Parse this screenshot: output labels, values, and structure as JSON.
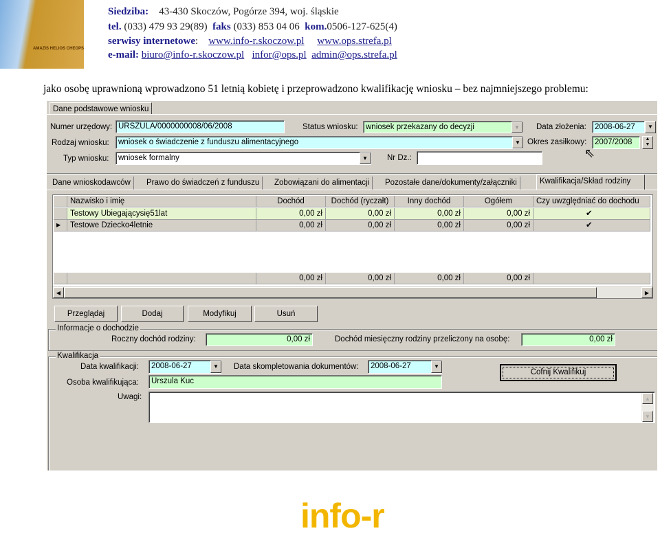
{
  "header": {
    "siedziba_label": "Siedziba:",
    "siedziba": "43-430 Skoczów,  Pogórze 394,  woj. śląskie",
    "tel_label": "tel.",
    "tel": "(033) 479 93 29(89)",
    "faks_label": "faks",
    "faks": "(033) 853 04 06",
    "kom_label": "kom.",
    "kom": "0506-127-625(4)",
    "serwisy_label": "serwisy internetowe",
    "serwisy_links": [
      "www.info-r.skoczow.pl",
      "www.ops.strefa.pl"
    ],
    "email_label": "e-mail:",
    "emails": [
      "biuro@info-r.skoczow.pl",
      "infor@ops.pl",
      "admin@ops.strefa.pl"
    ],
    "logo_text": "AMAZIS HELIOS CHEOPS"
  },
  "intro": "jako osobę uprawnioną wprowadzono 51 letnią kobietę i przeprowadzono kwalifikację wniosku – bez najmniejszego problemu:",
  "app": {
    "top_tab": "Dane podstawowe wniosku",
    "fields": {
      "numer_label": "Numer urzędowy:",
      "numer": "URSZULA/0000000008/06/2008",
      "status_label": "Status wniosku:",
      "status": "wniosek przekazany do decyzji",
      "data_zlozenia_label": "Data złożenia:",
      "data_zlozenia": "2008-06-27",
      "rodzaj_label": "Rodzaj wniosku:",
      "rodzaj": "wniosek o świadczenie z funduszu alimentacyjnego",
      "okres_label": "Okres zasiłkowy:",
      "okres": "2007/2008",
      "typ_label": "Typ wniosku:",
      "typ": "wniosek formalny",
      "nrdz_label": "Nr Dz.:",
      "nrdz": ""
    },
    "tabs": [
      "Dane wnioskodawców",
      "Prawo do świadczeń z funduszu",
      "Zobowiązani do alimentacji",
      "Pozostałe dane/dokumenty/załączniki",
      "Kwalifikacja/Skład rodziny"
    ],
    "active_tab": 4,
    "grid": {
      "columns": [
        "Nazwisko i imię",
        "Dochód",
        "Dochód (ryczałt)",
        "Inny dochód",
        "Ogółem",
        "Czy uwzględniać do dochodu"
      ],
      "rows": [
        {
          "name": "Testowy Ubiegającysię51lat",
          "values": [
            "0,00 zł",
            "0,00 zł",
            "0,00 zł",
            "0,00 zł"
          ],
          "checked": true
        },
        {
          "name": "Testowe Dziecko4letnie",
          "values": [
            "0,00 zł",
            "0,00 zł",
            "0,00 zł",
            "0,00 zł"
          ],
          "checked": true
        }
      ],
      "totals": [
        "0,00 zł",
        "0,00 zł",
        "0,00 zł",
        "0,00 zł"
      ]
    },
    "buttons": [
      "Przeglądaj",
      "Dodaj",
      "Modyfikuj",
      "Usuń"
    ],
    "income": {
      "group": "Informacje o dochodzie",
      "roczny_label": "Roczny dochód rodziny:",
      "roczny": "0,00 zł",
      "miesieczny_label": "Dochód miesięczny rodziny przeliczony na osobę:",
      "miesieczny": "0,00 zł"
    },
    "kwal": {
      "group": "Kwalifikacja",
      "data_label": "Data kwalifikacji:",
      "data": "2008-06-27",
      "kompl_label": "Data skompletowania dokumentów:",
      "kompl": "2008-06-27",
      "osoba_label": "Osoba kwalifikująca:",
      "osoba": "Urszula Kuc",
      "uwagi_label": "Uwagi:",
      "uwagi": "",
      "cofnij": "Cofnij Kwalifikuj"
    }
  },
  "footer_logo": "info-r",
  "colors": {
    "cyan": "#ccffff",
    "green": "#ccffcc",
    "selected_row": "#e6f5cf",
    "logo": "#f2b600"
  }
}
